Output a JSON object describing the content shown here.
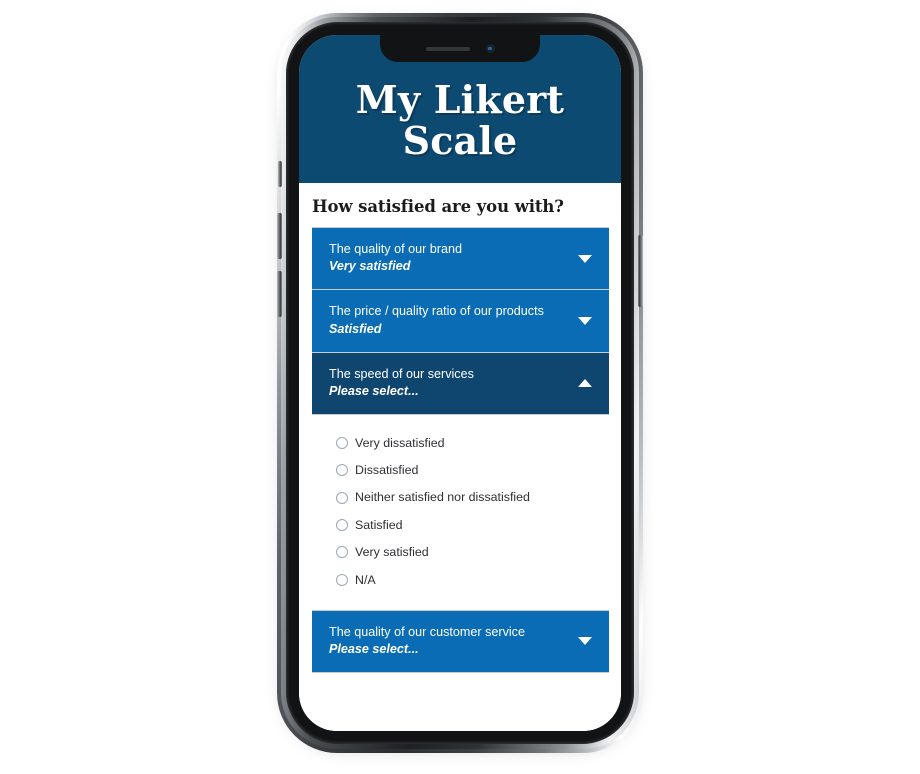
{
  "app": {
    "title": "My Likert Scale",
    "question_heading": "How satisfied are you with?"
  },
  "device": {
    "notch_speaker": "speaker-grille",
    "notch_camera": "front-camera",
    "buttons": [
      "mute-switch",
      "volume-up",
      "volume-down",
      "power"
    ]
  },
  "items": [
    {
      "label": "The quality of our brand",
      "value": "Very satisfied",
      "state": "collapsed",
      "caret": "chevron-down-icon"
    },
    {
      "label": "The price / quality ratio of our products",
      "value": "Satisfied",
      "state": "collapsed",
      "caret": "chevron-down-icon"
    },
    {
      "label": "The speed of our services",
      "value": "Please select...",
      "state": "expanded",
      "caret": "chevron-up-icon"
    },
    {
      "label": "The quality of our customer service",
      "value": "Please select...",
      "state": "collapsed",
      "caret": "chevron-down-icon"
    }
  ],
  "options": [
    {
      "label": "Very dissatisfied",
      "selected": false
    },
    {
      "label": "Dissatisfied",
      "selected": false
    },
    {
      "label": "Neither satisfied nor dissatisfied",
      "selected": false
    },
    {
      "label": "Satisfied",
      "selected": false
    },
    {
      "label": "Very satisfied",
      "selected": false
    },
    {
      "label": "N/A",
      "selected": false
    }
  ],
  "colors": {
    "header_navy": "#0d4a72",
    "row_blue": "#0a6cb4",
    "row_expanded_navy": "#0f4670",
    "text_white": "#ffffff",
    "option_text": "#2d2f33",
    "radio_border": "#9aa8bb",
    "divider": "#c8cacd"
  }
}
